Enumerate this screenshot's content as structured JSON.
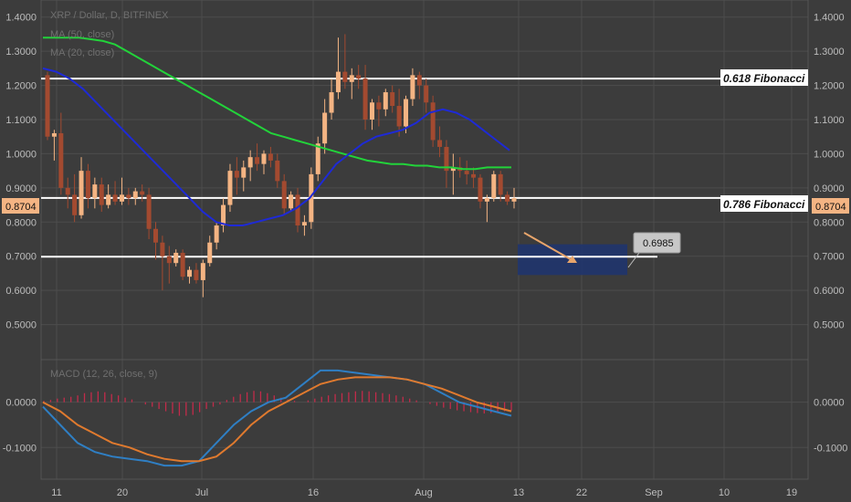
{
  "legend": {
    "main": "XRP / Dollar, D, BITFINEX",
    "ma1": "MA (50, close)",
    "ma2": "MA (20, close)",
    "macd": "MACD (12, 26, close, 9)"
  },
  "colors": {
    "background": "#3c3c3c",
    "grid": "#4c4c4c",
    "candle_up": "#f4b483",
    "candle_down": "#a34a30",
    "ma_green": "#22d33a",
    "ma_blue": "#1e2ad6",
    "macd_line": "#2f7fc4",
    "signal_line": "#e07a2e",
    "histogram": "#c22b4a",
    "fib_line": "#ffffff",
    "target_box": "#1d3470",
    "arrow": "#e8a56b"
  },
  "annotations": {
    "fib_618": "0.618 Fibonacci",
    "fib_786": "0.786 Fibonacci",
    "current_price": "0.8704",
    "target_price": "0.6985"
  },
  "chart_data": [
    {
      "type": "candlestick",
      "x_ticks": [
        "11",
        "20",
        "Jul",
        "16",
        "Aug",
        "13",
        "22",
        "Sep",
        "10",
        "19"
      ],
      "y_ticks": [
        "0.5000",
        "0.6000",
        "0.7000",
        "0.8000",
        "0.9000",
        "1.0000",
        "1.1000",
        "1.2000",
        "1.3000",
        "1.4000"
      ],
      "ylim": [
        0.4,
        1.45
      ],
      "grid": true,
      "horizontal_levels": [
        1.22,
        0.8704,
        0.6985
      ],
      "target_zone": {
        "top": 0.735,
        "bottom": 0.645
      },
      "candles_ohlc": [
        [
          1.23,
          1.24,
          1.04,
          1.05
        ],
        [
          1.05,
          1.07,
          0.98,
          1.06
        ],
        [
          1.06,
          1.12,
          0.88,
          0.9
        ],
        [
          0.9,
          0.93,
          0.84,
          0.88
        ],
        [
          0.88,
          0.94,
          0.8,
          0.82
        ],
        [
          0.82,
          0.99,
          0.81,
          0.95
        ],
        [
          0.95,
          0.97,
          0.84,
          0.87
        ],
        [
          0.87,
          0.93,
          0.84,
          0.91
        ],
        [
          0.91,
          0.93,
          0.83,
          0.85
        ],
        [
          0.85,
          0.91,
          0.84,
          0.88
        ],
        [
          0.88,
          0.92,
          0.85,
          0.86
        ],
        [
          0.86,
          0.93,
          0.85,
          0.88
        ],
        [
          0.88,
          0.9,
          0.85,
          0.87
        ],
        [
          0.87,
          0.9,
          0.85,
          0.89
        ],
        [
          0.89,
          0.91,
          0.86,
          0.88
        ],
        [
          0.88,
          0.9,
          0.75,
          0.78
        ],
        [
          0.78,
          0.8,
          0.69,
          0.74
        ],
        [
          0.74,
          0.76,
          0.6,
          0.7
        ],
        [
          0.7,
          0.73,
          0.62,
          0.68
        ],
        [
          0.68,
          0.72,
          0.67,
          0.71
        ],
        [
          0.71,
          0.72,
          0.63,
          0.64
        ],
        [
          0.64,
          0.67,
          0.62,
          0.66
        ],
        [
          0.66,
          0.68,
          0.62,
          0.63
        ],
        [
          0.63,
          0.69,
          0.58,
          0.68
        ],
        [
          0.68,
          0.76,
          0.67,
          0.74
        ],
        [
          0.74,
          0.8,
          0.72,
          0.79
        ],
        [
          0.79,
          0.87,
          0.77,
          0.85
        ],
        [
          0.85,
          0.97,
          0.83,
          0.95
        ],
        [
          0.95,
          0.99,
          0.88,
          0.93
        ],
        [
          0.93,
          0.98,
          0.89,
          0.96
        ],
        [
          0.96,
          1.01,
          0.92,
          0.99
        ],
        [
          0.99,
          1.03,
          0.95,
          0.97
        ],
        [
          0.97,
          1.01,
          0.94,
          1.0
        ],
        [
          1.0,
          1.02,
          0.96,
          0.98
        ],
        [
          0.98,
          1.0,
          0.9,
          0.92
        ],
        [
          0.92,
          0.94,
          0.82,
          0.84
        ],
        [
          0.84,
          0.89,
          0.83,
          0.88
        ],
        [
          0.88,
          0.9,
          0.77,
          0.79
        ],
        [
          0.79,
          0.82,
          0.76,
          0.8
        ],
        [
          0.8,
          0.96,
          0.78,
          0.94
        ],
        [
          0.94,
          1.05,
          0.92,
          1.03
        ],
        [
          1.03,
          1.16,
          1.0,
          1.12
        ],
        [
          1.12,
          1.22,
          1.1,
          1.18
        ],
        [
          1.18,
          1.34,
          1.16,
          1.24
        ],
        [
          1.24,
          1.35,
          1.19,
          1.21
        ],
        [
          1.21,
          1.25,
          1.16,
          1.23
        ],
        [
          1.23,
          1.26,
          1.19,
          1.22
        ],
        [
          1.22,
          1.26,
          1.07,
          1.1
        ],
        [
          1.1,
          1.16,
          1.07,
          1.15
        ],
        [
          1.15,
          1.17,
          1.08,
          1.13
        ],
        [
          1.13,
          1.19,
          1.11,
          1.18
        ],
        [
          1.18,
          1.2,
          1.12,
          1.14
        ],
        [
          1.14,
          1.19,
          1.05,
          1.08
        ],
        [
          1.08,
          1.17,
          1.06,
          1.16
        ],
        [
          1.16,
          1.25,
          1.14,
          1.23
        ],
        [
          1.23,
          1.24,
          1.16,
          1.2
        ],
        [
          1.2,
          1.22,
          1.12,
          1.15
        ],
        [
          1.15,
          1.17,
          1.02,
          1.04
        ],
        [
          1.04,
          1.08,
          0.99,
          1.02
        ],
        [
          1.02,
          1.04,
          0.9,
          0.95
        ],
        [
          0.95,
          1.0,
          0.88,
          0.96
        ],
        [
          0.96,
          0.99,
          0.93,
          0.95
        ],
        [
          0.95,
          0.98,
          0.91,
          0.94
        ],
        [
          0.94,
          0.96,
          0.9,
          0.93
        ],
        [
          0.93,
          0.94,
          0.84,
          0.86
        ],
        [
          0.86,
          0.88,
          0.8,
          0.87
        ],
        [
          0.87,
          0.95,
          0.86,
          0.94
        ],
        [
          0.94,
          0.95,
          0.86,
          0.88
        ],
        [
          0.88,
          0.89,
          0.85,
          0.86
        ],
        [
          0.86,
          0.9,
          0.84,
          0.87
        ]
      ],
      "ma_green": [
        1.34,
        1.34,
        1.34,
        1.34,
        1.335,
        1.33,
        1.32,
        1.3,
        1.28,
        1.26,
        1.24,
        1.22,
        1.2,
        1.18,
        1.16,
        1.14,
        1.12,
        1.1,
        1.08,
        1.06,
        1.05,
        1.04,
        1.03,
        1.02,
        1.01,
        1.0,
        0.99,
        0.98,
        0.975,
        0.97,
        0.97,
        0.965,
        0.965,
        0.96,
        0.96,
        0.955,
        0.955,
        0.96,
        0.96,
        0.96
      ],
      "ma_blue": [
        1.25,
        1.24,
        1.22,
        1.19,
        1.15,
        1.11,
        1.07,
        1.03,
        0.99,
        0.95,
        0.91,
        0.87,
        0.83,
        0.8,
        0.79,
        0.79,
        0.8,
        0.81,
        0.82,
        0.84,
        0.87,
        0.92,
        0.97,
        1.0,
        1.03,
        1.05,
        1.06,
        1.07,
        1.09,
        1.12,
        1.13,
        1.12,
        1.1,
        1.07,
        1.04,
        1.01
      ],
      "macd": {
        "y_ticks": [
          "-0.1000",
          "0.0000"
        ],
        "ylim": [
          -0.17,
          0.09
        ],
        "macd_line": [
          -0.01,
          -0.05,
          -0.09,
          -0.11,
          -0.12,
          -0.125,
          -0.13,
          -0.14,
          -0.14,
          -0.13,
          -0.09,
          -0.05,
          -0.02,
          0.0,
          0.01,
          0.04,
          0.07,
          0.07,
          0.065,
          0.06,
          0.055,
          0.05,
          0.04,
          0.02,
          0.0,
          -0.01,
          -0.02,
          -0.03
        ],
        "signal_line": [
          0.0,
          -0.02,
          -0.05,
          -0.07,
          -0.09,
          -0.1,
          -0.115,
          -0.125,
          -0.13,
          -0.13,
          -0.12,
          -0.09,
          -0.05,
          -0.02,
          0.0,
          0.02,
          0.04,
          0.05,
          0.055,
          0.055,
          0.055,
          0.05,
          0.04,
          0.03,
          0.015,
          0.0,
          -0.01,
          -0.02
        ],
        "histogram": [
          0.003,
          0.005,
          0.008,
          0.01,
          0.012,
          0.015,
          0.02,
          0.022,
          0.024,
          0.022,
          0.018,
          0.015,
          0.01,
          0.006,
          0.0,
          -0.005,
          -0.01,
          -0.015,
          -0.02,
          -0.025,
          -0.03,
          -0.03,
          -0.028,
          -0.022,
          -0.015,
          -0.01,
          -0.005,
          0.005,
          0.012,
          0.018,
          0.022,
          0.025,
          0.024,
          0.02,
          0.015,
          0.01,
          0.006,
          0.003,
          0.0,
          0.004,
          0.008,
          0.012,
          0.015,
          0.018,
          0.02,
          0.022,
          0.024,
          0.025,
          0.024,
          0.022,
          0.02,
          0.018,
          0.015,
          0.012,
          0.008,
          0.004,
          0.0,
          -0.004,
          -0.008,
          -0.012,
          -0.015,
          -0.018,
          -0.02,
          -0.022,
          -0.024,
          -0.025,
          -0.024,
          -0.022,
          -0.02,
          -0.018
        ]
      }
    }
  ]
}
